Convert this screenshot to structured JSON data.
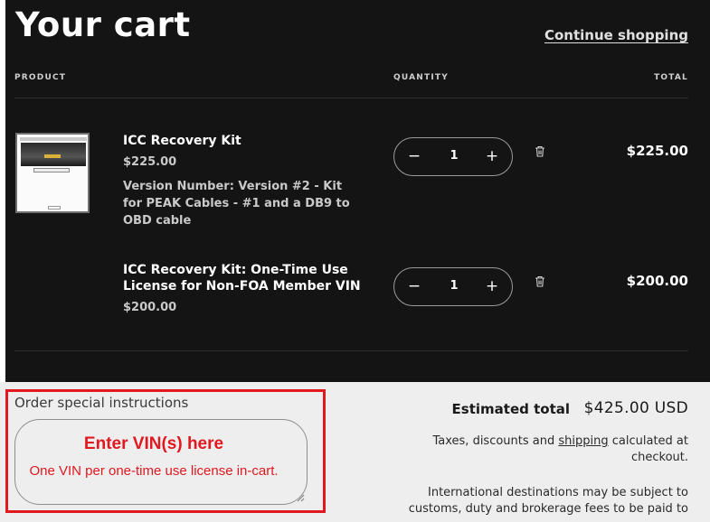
{
  "header": {
    "title": "Your cart",
    "continue_link": "Continue shopping"
  },
  "table": {
    "columns": [
      "PRODUCT",
      "QUANTITY",
      "TOTAL"
    ]
  },
  "items": [
    {
      "name": "ICC Recovery Kit",
      "price": "$225.00",
      "variant_lines": [
        "Version Number: Version #2 - Kit",
        "for PEAK Cables - #1 and a DB9 to",
        "OBD cable"
      ],
      "quantity": "1",
      "total": "$225.00",
      "has_image": true
    },
    {
      "name_lines": [
        "ICC Recovery Kit: One-Time Use",
        "License for Non-FOA Member VIN"
      ],
      "price": "$200.00",
      "quantity": "1",
      "total": "$200.00",
      "has_image": false
    }
  ],
  "qty_controls": {
    "minus": "−",
    "plus": "+"
  },
  "instructions": {
    "label": "Order special instructions",
    "overlay_title": "Enter VIN(s) here",
    "overlay_sub": "One VIN per one-time use license in-cart."
  },
  "summary": {
    "estimated_label": "Estimated total",
    "estimated_value": "$425.00 USD",
    "tax_before": "Taxes, discounts and ",
    "tax_link": "shipping",
    "tax_after": " calculated at checkout.",
    "intl_line1": "International destinations may be subject to",
    "intl_line2": "customs, duty and brokerage fees to be paid to"
  },
  "colors": {
    "dark_bg": "#141414",
    "light_bg": "#eeeeee",
    "highlight_red": "#e0181f"
  },
  "icons": [
    "minus-icon",
    "plus-icon",
    "trash-icon",
    "resize-handle-icon"
  ]
}
